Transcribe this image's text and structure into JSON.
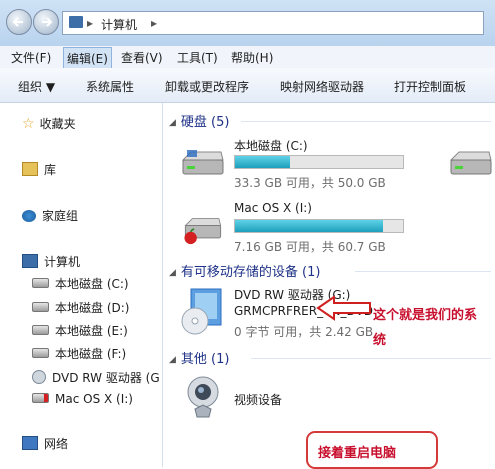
{
  "address": {
    "segment": "计算机"
  },
  "menu": [
    {
      "label": "文件(F)"
    },
    {
      "label": "编辑(E)"
    },
    {
      "label": "查看(V)"
    },
    {
      "label": "工具(T)"
    },
    {
      "label": "帮助(H)"
    }
  ],
  "toolbar": [
    {
      "label": "组织 ▼"
    },
    {
      "label": "系统属性"
    },
    {
      "label": "卸载或更改程序"
    },
    {
      "label": "映射网络驱动器"
    },
    {
      "label": "打开控制面板"
    }
  ],
  "sidebar": {
    "favorites": "收藏夹",
    "libraries": "库",
    "homegroup": "家庭组",
    "computer": "计算机",
    "drives": [
      {
        "label": "本地磁盘 (C:)"
      },
      {
        "label": "本地磁盘 (D:)"
      },
      {
        "label": "本地磁盘 (E:)"
      },
      {
        "label": "本地磁盘 (F:)"
      },
      {
        "label": "DVD RW 驱动器 (G"
      },
      {
        "label": "Mac OS X (I:)"
      }
    ],
    "network": "网络"
  },
  "groups": {
    "hdd": "硬盘 (5)",
    "removable": "有可移动存储的设备 (1)",
    "other": "其他 (1)"
  },
  "drives": [
    {
      "name": "本地磁盘 (C:)",
      "size": "33.3 GB 可用，共 50.0 GB",
      "fill": 0.33
    },
    {
      "name": "Mac OS X (I:)",
      "size": "7.16 GB 可用，共 60.7 GB",
      "fill": 0.88
    }
  ],
  "dvd": {
    "name": "DVD RW 驱动器 (G:)",
    "label": "GRMCPRFRER_CN_DVD",
    "size": "0 字节 可用，共 2.42 GB"
  },
  "video": {
    "name": "视频设备"
  },
  "annotations": {
    "line1": "这个就是我们的系",
    "line2": "统",
    "restart": "接着重启电脑"
  },
  "colors": {
    "accent": "#1e3287",
    "bar_fill": "#1f9fbc",
    "annotation": "#c8102e"
  }
}
